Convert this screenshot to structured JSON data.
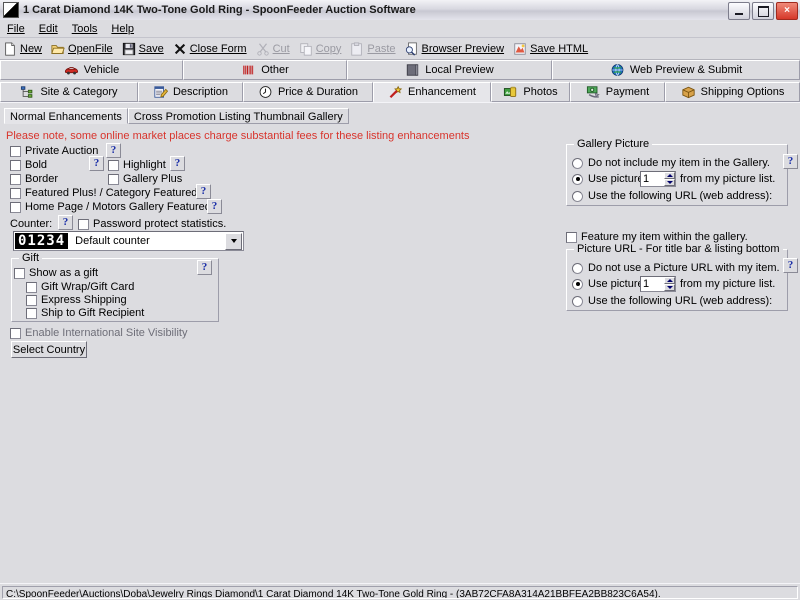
{
  "window": {
    "title": "1 Carat Diamond 14K Two-Tone Gold Ring - SpoonFeeder Auction Software",
    "minimize_label": "Minimize",
    "maximize_label": "Maximize",
    "close_label": "×"
  },
  "menu": [
    {
      "label": "File"
    },
    {
      "label": "Edit"
    },
    {
      "label": "Tools"
    },
    {
      "label": "Help"
    }
  ],
  "toolbar": [
    {
      "label": "New",
      "icon": "page-icon",
      "disabled": false
    },
    {
      "label": "OpenFile",
      "icon": "folder-open-icon",
      "disabled": false
    },
    {
      "label": "Save",
      "icon": "floppy-disk-icon",
      "disabled": false
    },
    {
      "label": "Close Form",
      "icon": "x-mark-icon",
      "disabled": false
    },
    {
      "label": "Cut",
      "icon": "scissors-icon",
      "disabled": true
    },
    {
      "label": "Copy",
      "icon": "copy-icon",
      "disabled": true
    },
    {
      "label": "Paste",
      "icon": "clipboard-icon",
      "disabled": true
    },
    {
      "label": "Browser Preview",
      "icon": "magnifier-page-icon",
      "disabled": false
    },
    {
      "label": "Save HTML",
      "icon": "html-save-icon",
      "disabled": false
    }
  ],
  "tabs_top": [
    {
      "label": "Vehicle",
      "icon": "car-icon",
      "selected": false
    },
    {
      "label": "Other",
      "icon": "barcode-icon",
      "selected": false
    },
    {
      "label": "Local Preview",
      "icon": "monitor-icon",
      "selected": false
    },
    {
      "label": "Web Preview & Submit",
      "icon": "globe-icon",
      "selected": false
    }
  ],
  "tabs_bottom": [
    {
      "label": "Site & Category",
      "icon": "sitemap-icon",
      "selected": false
    },
    {
      "label": "Description",
      "icon": "notepad-pencil-icon",
      "selected": false
    },
    {
      "label": "Price & Duration",
      "icon": "clock-icon",
      "selected": false
    },
    {
      "label": "Enhancement",
      "icon": "magic-wand-icon",
      "selected": true
    },
    {
      "label": "Photos",
      "icon": "photos-icon",
      "selected": false
    },
    {
      "label": "Payment",
      "icon": "money-icon",
      "selected": false
    },
    {
      "label": "Shipping Options",
      "icon": "box-icon",
      "selected": false
    }
  ],
  "subtabs": [
    {
      "label": "Normal Enhancements",
      "selected": true
    },
    {
      "label": "Cross Promotion Listing Thumbnail Gallery",
      "selected": false
    }
  ],
  "notice": "Please note, some online market places charge substantial fees for these listing enhancements",
  "left": {
    "checkboxes": [
      {
        "label": "Private Auction",
        "checked": false
      },
      {
        "label": "Bold",
        "checked": false
      },
      {
        "label": "Highlight",
        "checked": false
      },
      {
        "label": "Border",
        "checked": false
      },
      {
        "label": "Gallery Plus",
        "checked": false
      },
      {
        "label": "Featured Plus! / Category Featured",
        "checked": false
      },
      {
        "label": "Home Page / Motors Gallery Featured",
        "checked": false
      }
    ],
    "counter_label": "Counter:",
    "password_protect_label": "Password protect statistics.",
    "password_protect_checked": false,
    "counter_value": "01234",
    "counter_style": "Default counter",
    "gift": {
      "title": "Gift",
      "show_as_gift_label": "Show as a gift",
      "show_as_gift_checked": false,
      "options": [
        {
          "label": "Gift Wrap/Gift Card",
          "checked": false
        },
        {
          "label": "Express Shipping",
          "checked": false
        },
        {
          "label": "Ship to Gift Recipient",
          "checked": false
        }
      ]
    },
    "international_label": "Enable International Site Visibility",
    "international_checked": false,
    "select_country_label": "Select Country"
  },
  "right": {
    "gallery_picture": {
      "title": "Gallery Picture",
      "options": [
        {
          "label": "Do not include my item in the Gallery.",
          "selected": false
        },
        {
          "label_before": "Use picture",
          "label_after": "from my picture list.",
          "value": "1",
          "selected": true
        },
        {
          "label": "Use the following URL (web address):",
          "selected": false
        }
      ]
    },
    "feature_in_gallery_label": "Feature my item within the gallery.",
    "feature_in_gallery_checked": false,
    "picture_url": {
      "title": "Picture URL - For title bar & listing bottom",
      "options": [
        {
          "label": "Do not use a Picture URL with my item.",
          "selected": false
        },
        {
          "label_before": "Use picture",
          "label_after": "from my picture list.",
          "value": "1",
          "selected": true
        },
        {
          "label": "Use the following URL (web address):",
          "selected": false
        }
      ]
    }
  },
  "help_button_label": "?",
  "statusbar": {
    "path": "C:\\SpoonFeeder\\Auctions\\Doba\\Jewelry Rings Diamond\\1 Carat Diamond 14K Two-Tone Gold Ring - (3AB72CFA8A314A21BBFEA2BB823C6A54)."
  },
  "colors": {
    "face": "#dcdce0",
    "notice": "#d8342c",
    "help": "#1a2ea8",
    "lcd_bg": "#000000",
    "lcd_fg": "#ffffff"
  }
}
